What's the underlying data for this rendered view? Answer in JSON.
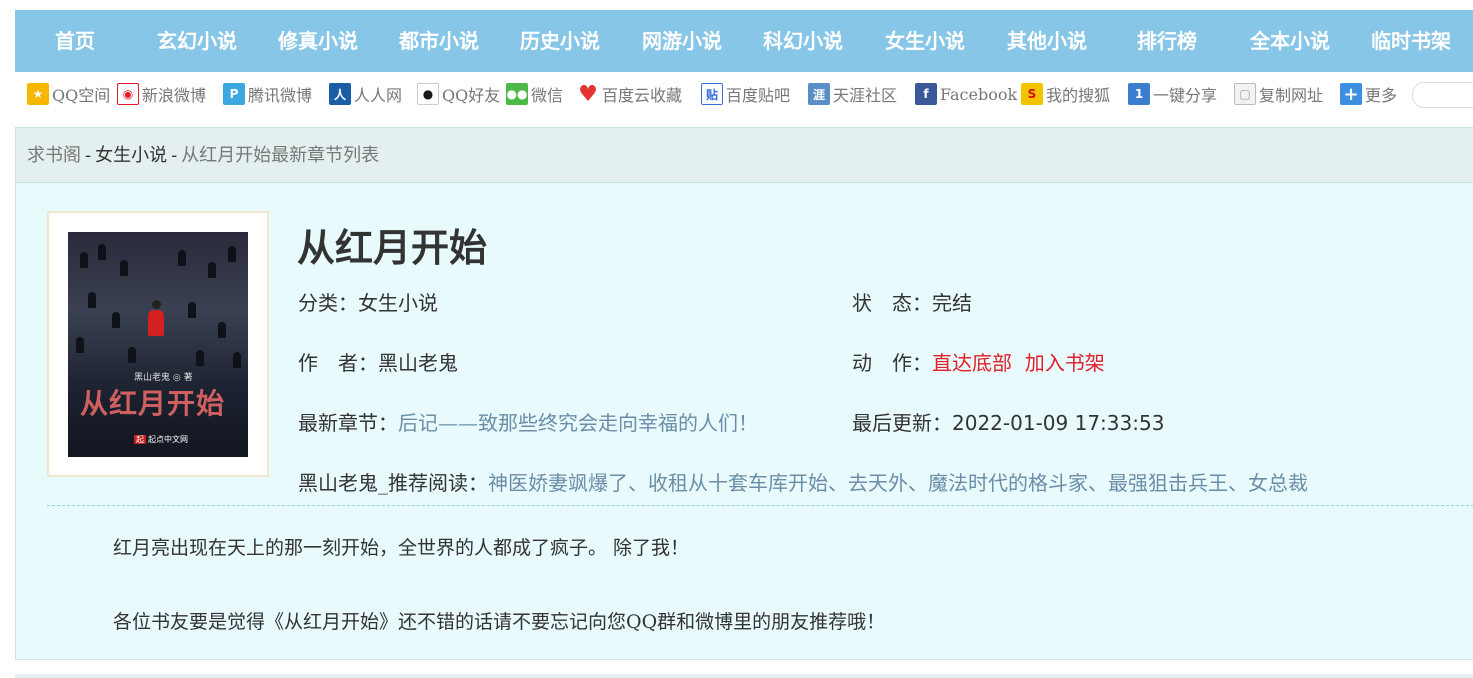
{
  "nav": {
    "items": [
      "首页",
      "玄幻小说",
      "修真小说",
      "都市小说",
      "历史小说",
      "网游小说",
      "科幻小说",
      "女生小说",
      "其他小说",
      "排行榜",
      "全本小说",
      "临时书架"
    ]
  },
  "share": {
    "items": [
      {
        "label": "QQ空间",
        "icon": "qzone-icon",
        "color": "#f5b700"
      },
      {
        "label": "新浪微博",
        "icon": "weibo-icon",
        "color": "#e6162d"
      },
      {
        "label": "腾讯微博",
        "icon": "tencent-weibo-icon",
        "color": "#3ba9e0"
      },
      {
        "label": "人人网",
        "icon": "renren-icon",
        "color": "#1b5ea8"
      },
      {
        "label": "QQ好友",
        "icon": "qq-icon",
        "color": "#1a1a1a"
      },
      {
        "label": "微信",
        "icon": "wechat-icon",
        "color": "#4cb848"
      },
      {
        "label": "百度云收藏",
        "icon": "heart-icon",
        "color": "#e63434"
      },
      {
        "label": "百度贴吧",
        "icon": "tieba-icon",
        "color": "#3b6fd8"
      },
      {
        "label": "天涯社区",
        "icon": "tianya-icon",
        "color": "#5b8ec6"
      },
      {
        "label": "Facebook",
        "icon": "facebook-icon",
        "color": "#3b5998"
      },
      {
        "label": "我的搜狐",
        "icon": "sohu-icon",
        "color": "#f5c400"
      },
      {
        "label": "一键分享",
        "icon": "one-click-share-icon",
        "color": "#3b7ed0"
      },
      {
        "label": "复制网址",
        "icon": "copy-icon",
        "color": "#cfcfcf"
      },
      {
        "label": "更多",
        "icon": "plus-icon",
        "color": "#3b8ee0"
      }
    ]
  },
  "breadcrumb": {
    "site": "求书阁",
    "category": "女生小说",
    "current": "从红月开始最新章节列表",
    "separator": "-"
  },
  "book": {
    "title": "从红月开始",
    "cover_title": "从红月开始",
    "cover_author": "黑山老鬼 ◎ 著",
    "cover_publisher": "起点中文网",
    "cover_publisher_badge": "起",
    "category_label": "分类：",
    "category": "女生小说",
    "status_label": "状　态：",
    "status": "完结",
    "author_label": "作　者：",
    "author": "黑山老鬼",
    "action_label": "动　作：",
    "action_bottom": "直达底部",
    "action_shelf": "加入书架",
    "latest_label": "最新章节：",
    "latest_chapter": "后记——致那些终究会走向幸福的人们！",
    "updated_label": "最后更新：",
    "updated": "2022-01-09 17:33:53",
    "recommend_label": "黑山老鬼_推荐阅读：",
    "recommend_text": "神医娇妻飒爆了、收租从十套车库开始、去天外、魔法时代的格斗家、最强狙击兵王、女总裁",
    "intro": "红月亮出现在天上的那一刻开始，全世界的人都成了疯子。 除了我！",
    "promo": "各位书友要是觉得《从红月开始》还不错的话请不要忘记向您QQ群和微博里的朋友推荐哦！"
  }
}
